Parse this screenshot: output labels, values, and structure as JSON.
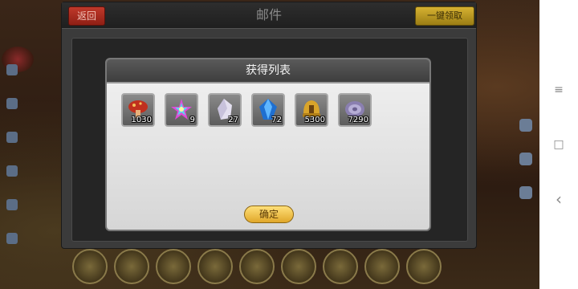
{
  "mail_window": {
    "title": "邮件",
    "back_label": "返回",
    "claim_all_label": "一键领取"
  },
  "reward_dialog": {
    "title": "获得列表",
    "confirm_label": "确定",
    "items": [
      {
        "icon": "red-mushroom-icon",
        "quantity": "1030"
      },
      {
        "icon": "rainbow-star-icon",
        "quantity": "9"
      },
      {
        "icon": "white-crystal-icon",
        "quantity": "27"
      },
      {
        "icon": "blue-gem-icon",
        "quantity": "72"
      },
      {
        "icon": "gold-helmet-icon",
        "quantity": "5300"
      },
      {
        "icon": "silver-shield-icon",
        "quantity": "7290"
      }
    ]
  },
  "nav_bar": {
    "menu_icon": "≡",
    "home_icon": "□",
    "back_icon": "‹"
  },
  "colors": {
    "back_button": "#c0392b",
    "claim_button": "#d6b232",
    "confirm_button": "#f2c04a",
    "dialog_header": "#4a4a4a"
  }
}
